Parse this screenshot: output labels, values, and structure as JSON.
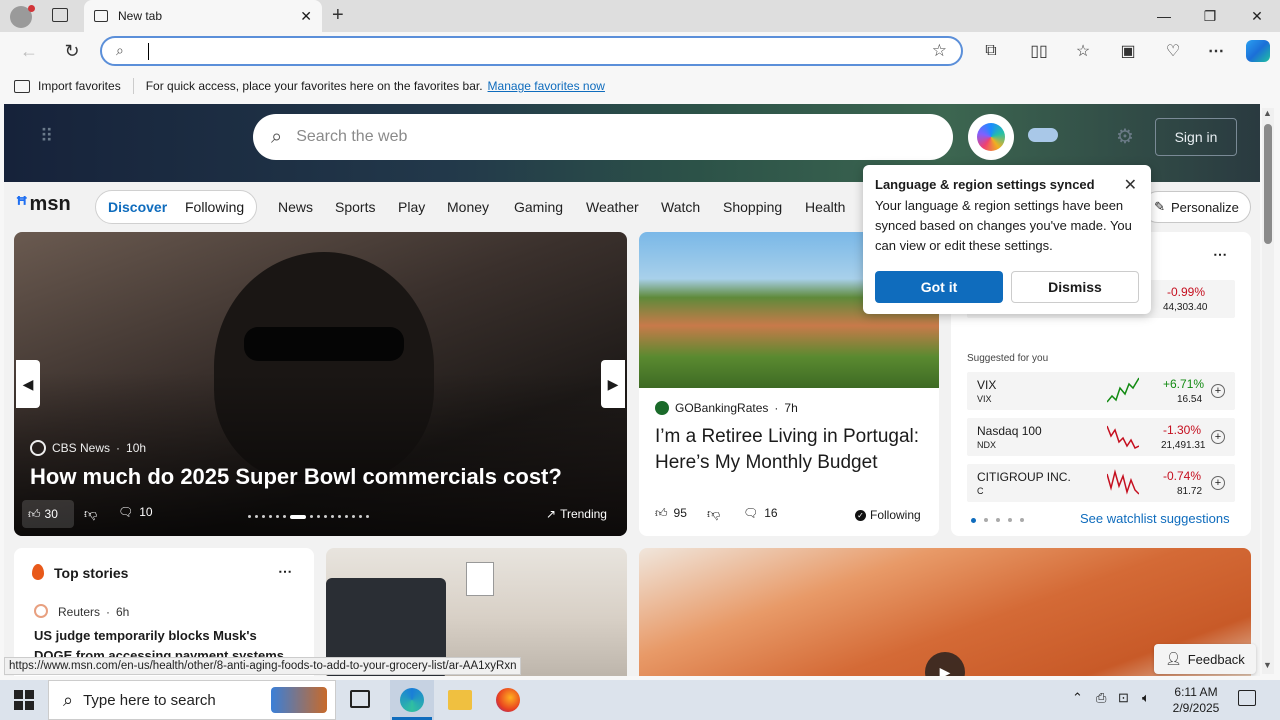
{
  "browser": {
    "tab_title": "New tab",
    "address_value": "",
    "favbar_import": "Import favorites",
    "favbar_text": "For quick access, place your favorites here on the favorites bar.",
    "favbar_link": "Manage favorites now"
  },
  "msn": {
    "search_placeholder": "Search the web",
    "sign_in": "Sign in",
    "logo": "msn",
    "tabs": [
      "Discover",
      "Following"
    ],
    "nav": [
      "News",
      "Sports",
      "Play",
      "Money",
      "Gaming",
      "Weather",
      "Watch",
      "Shopping",
      "Health"
    ],
    "personalize": "Personalize"
  },
  "hero": {
    "source": "CBS News",
    "time": "10h",
    "title": "How much do 2025 Super Bowl commercials cost?",
    "likes": "30",
    "comments": "10",
    "trending": "Trending"
  },
  "article2": {
    "source": "GOBankingRates",
    "time": "7h",
    "title": "I’m a Retiree Living in Portugal: Here’s My Monthly Budget",
    "likes": "95",
    "comments": "16",
    "following": "Following"
  },
  "popup": {
    "title": "Language & region settings synced",
    "body": "Your language & region settings have been synced based on changes you've made. You can view or edit these settings.",
    "got_it": "Got it",
    "dismiss": "Dismiss"
  },
  "watchlist": {
    "top_change": "-0.99%",
    "top_value": "44,303.40",
    "suggested_label": "Suggested for you",
    "stocks": [
      {
        "name": "VIX",
        "ticker": "VIX",
        "change": "+6.71%",
        "price": "16.54",
        "color": "#128a12"
      },
      {
        "name": "Nasdaq 100",
        "ticker": "NDX",
        "change": "-1.30%",
        "price": "21,491.31",
        "color": "#c50f1f"
      },
      {
        "name": "CITIGROUP INC.",
        "ticker": "C",
        "change": "-0.74%",
        "price": "81.72",
        "color": "#c50f1f"
      }
    ],
    "see_more": "See watchlist suggestions"
  },
  "topstories": {
    "title": "Top stories",
    "source": "Reuters",
    "time": "6h",
    "headline": "US judge temporarily blocks Musk's DOGE from accessing payment systems"
  },
  "status_url": "https://www.msn.com/en-us/health/other/8-anti-aging-foods-to-add-to-your-grocery-list/ar-AA1xyRxn",
  "feedback": "Feedback",
  "taskbar": {
    "search_placeholder": "Type here to search",
    "time": "6:11 AM",
    "date": "2/9/2025"
  },
  "colors": {
    "accent": "#0f6cbd",
    "down": "#c50f1f",
    "up": "#128a12"
  }
}
